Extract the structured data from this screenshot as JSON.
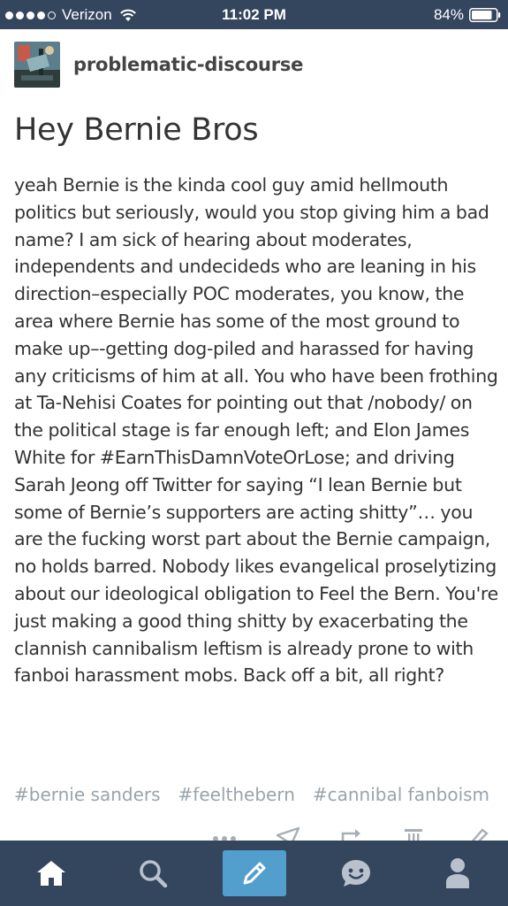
{
  "status_bar": {
    "carrier": "Verizon",
    "time": "11:02 PM",
    "battery_percent": "84%",
    "battery_level": 0.84,
    "signal_bars": 4,
    "icons": [
      "wifi-icon",
      "battery-icon"
    ]
  },
  "post": {
    "blog_name": "problematic-discourse",
    "title": "Hey Bernie Bros",
    "body": "yeah Bernie is the kinda cool guy amid hellmouth politics but seriously, would you stop giving him a bad name? I am sick of hearing about moderates, independents and undecideds who are leaning in his direction–especially POC moderates, you know, the area where Bernie has some of the most ground to make up–-getting dog-piled and harassed for having any criticisms of him at all. You who have been frothing at Ta-Nehisi Coates for pointing out that /nobody/ on the political stage is far enough left; and Elon James White for #EarnThisDamnVoteOrLose; and driving Sarah Jeong off Twitter for saying “I lean Bernie but some of Bernie’s supporters are acting shitty”… you are the fucking worst part about the Bernie campaign, no holds barred. Nobody likes evangelical proselytizing about our ideological obligation to Feel the Bern. You're just making a good thing shitty by exacerbating the clannish cannibalism leftism is already prone to with fanboi harassment mobs. Back off a bit, all right?",
    "tags": [
      "#bernie sanders",
      "#feelthebern",
      "#cannibal fanboism"
    ],
    "action_icons": [
      "more-icon",
      "share-icon",
      "reblog-icon",
      "delete-icon",
      "edit-icon"
    ]
  },
  "tab_bar": {
    "tabs": [
      "home-icon",
      "search-icon",
      "compose-icon",
      "activity-icon",
      "account-icon"
    ],
    "colors": {
      "background": "#34465e",
      "compose": "#529ecc"
    }
  }
}
